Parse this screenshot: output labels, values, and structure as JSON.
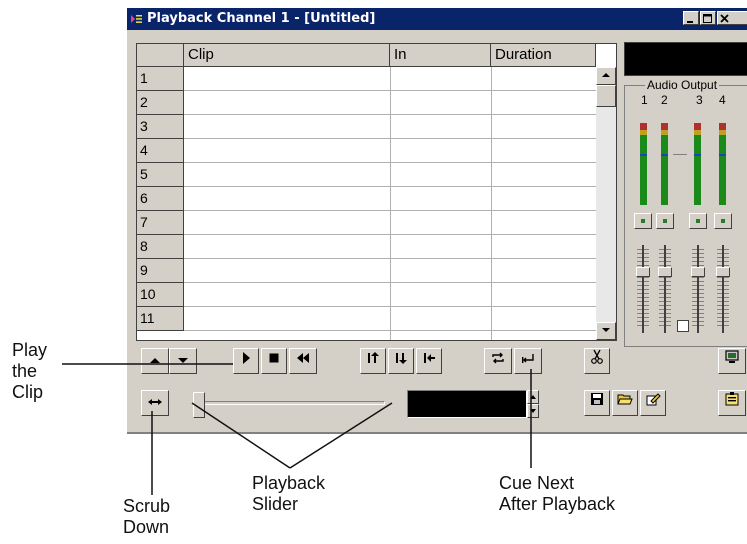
{
  "window": {
    "title": "Playback Channel 1 - [Untitled]",
    "controls": [
      "minimize-icon",
      "maximize-icon",
      "close-icon"
    ]
  },
  "clip_list": {
    "columns": [
      "Clip",
      "In",
      "Duration"
    ],
    "rows": [
      "1",
      "2",
      "3",
      "4",
      "5",
      "6",
      "7",
      "8",
      "9",
      "10",
      "11"
    ]
  },
  "audio_output": {
    "label": "Audio Output",
    "channels": [
      "1",
      "2",
      "3",
      "4"
    ]
  },
  "transport_icons": [
    "move-up-icon",
    "move-down-icon",
    "play-icon",
    "stop-icon",
    "rewind-icon",
    "mark-in-icon",
    "mark-out-icon",
    "go-to-in-icon",
    "loop-icon",
    "cue-next-icon",
    "cut-icon",
    "monitor-icon",
    "scrub-icon",
    "save-icon",
    "open-folder-icon",
    "edit-icon",
    "properties-icon"
  ],
  "callouts": {
    "play_clip": [
      "Play",
      "the",
      "Clip"
    ],
    "scrub_down": [
      "Scrub",
      "Down"
    ],
    "playback_slider": [
      "Playback",
      "Slider"
    ],
    "cue_next": [
      "Cue Next",
      "After Playback"
    ]
  },
  "colors": {
    "titlebar": "#0a246a",
    "window_face": "#d4d0c8",
    "meter_green": "#1a8a1a",
    "display_black": "#000000"
  }
}
